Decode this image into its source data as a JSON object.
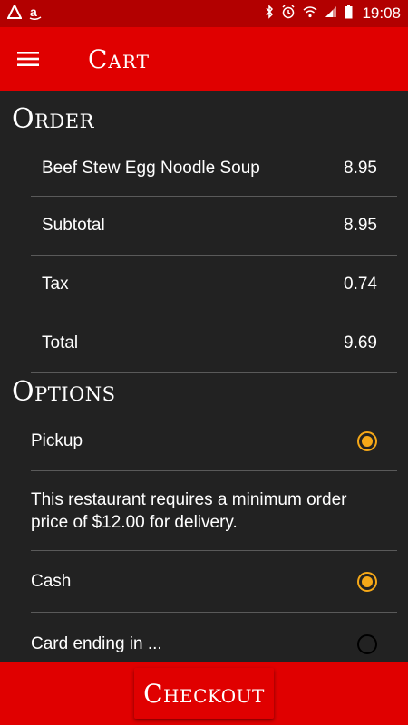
{
  "status_bar": {
    "time": "19:08",
    "left_icons": [
      "notification-icon",
      "amazon-icon"
    ],
    "right_icons": [
      "bluetooth-icon",
      "alarm-icon",
      "wifi-icon",
      "signal-icon",
      "battery-icon"
    ]
  },
  "app_bar": {
    "title": "Cart",
    "menu_icon": "hamburger-menu-icon"
  },
  "order": {
    "heading": "Order",
    "items": [
      {
        "label": "Beef Stew Egg Noodle Soup",
        "value": "8.95"
      },
      {
        "label": "Subtotal",
        "value": "8.95"
      },
      {
        "label": "Tax",
        "value": "0.74"
      },
      {
        "label": "Total",
        "value": "9.69"
      }
    ]
  },
  "options": {
    "heading": "Options",
    "pickup_label": "Pickup",
    "pickup_selected": true,
    "notice": "This restaurant requires a minimum order price of $12.00 for delivery.",
    "cash_label": "Cash",
    "cash_selected": true,
    "card_label": "Card ending in ...",
    "card_selected": false
  },
  "checkout": {
    "label": "Checkout"
  },
  "colors": {
    "primary": "#e00000",
    "status_bar": "#b20000",
    "background": "#222222",
    "accent": "#f5a818"
  }
}
